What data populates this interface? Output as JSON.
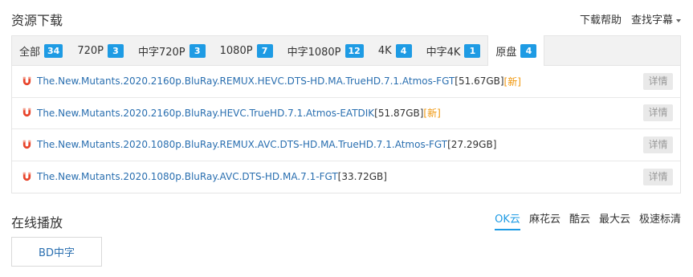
{
  "download": {
    "title": "资源下载",
    "help_link": "下载帮助",
    "subtitle_link": "查找字幕"
  },
  "tabs": [
    {
      "label": "全部",
      "count": "34"
    },
    {
      "label": "720P",
      "count": "3"
    },
    {
      "label": "中字720P",
      "count": "3"
    },
    {
      "label": "1080P",
      "count": "7"
    },
    {
      "label": "中字1080P",
      "count": "12"
    },
    {
      "label": "4K",
      "count": "4"
    },
    {
      "label": "中字4K",
      "count": "1"
    },
    {
      "label": "原盘",
      "count": "4"
    }
  ],
  "active_tab": "原盘",
  "files": [
    {
      "name": "The.New.Mutants.2020.2160p.BluRay.REMUX.HEVC.DTS-HD.MA.TrueHD.7.1.Atmos-FGT",
      "size": "[51.67GB]",
      "badge": "[新]",
      "detail": "详情"
    },
    {
      "name": "The.New.Mutants.2020.2160p.BluRay.HEVC.TrueHD.7.1.Atmos-EATDIK",
      "size": "[51.87GB]",
      "badge": "[新]",
      "detail": "详情"
    },
    {
      "name": "The.New.Mutants.2020.1080p.BluRay.REMUX.AVC.DTS-HD.MA.TrueHD.7.1.Atmos-FGT",
      "size": "[27.29GB]",
      "badge": "",
      "detail": "详情"
    },
    {
      "name": "The.New.Mutants.2020.1080p.BluRay.AVC.DTS-HD.MA.7.1-FGT",
      "size": "[33.72GB]",
      "badge": "",
      "detail": "详情"
    }
  ],
  "online": {
    "title": "在线播放",
    "sources": [
      "OK云",
      "麻花云",
      "酷云",
      "最大云",
      "极速标清"
    ],
    "active_source": "OK云",
    "play_button": "BD中字"
  },
  "colors": {
    "accent": "#1e9be4",
    "link": "#2a6fb0",
    "new_badge": "#f0960a",
    "magnet": "#e8452c"
  },
  "icons": {
    "file": "magnet-icon",
    "dropdown": "caret-down-icon"
  }
}
